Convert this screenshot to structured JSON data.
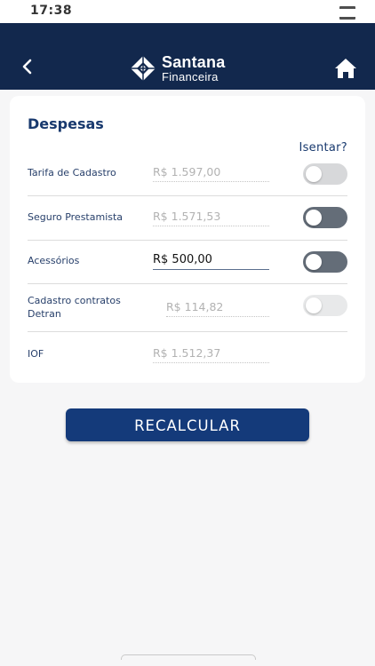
{
  "status_bar": {
    "time": "17:38"
  },
  "header": {
    "brand_name": "Santana",
    "brand_sub": "Financeira",
    "back_icon": "chevron-left-icon",
    "home_icon": "home-icon",
    "background_color": "#12284d"
  },
  "despesas": {
    "title": "Despesas",
    "isentar_label": "Isentar?",
    "rows": [
      {
        "label": "Tarifa de Cadastro",
        "value": "R$ 1.597,00",
        "toggle": "off"
      },
      {
        "label": "Seguro Prestamista",
        "value": "R$ 1.571,53",
        "toggle": "off"
      },
      {
        "label": "Acessórios",
        "value": "R$ 500,00",
        "toggle": "off"
      },
      {
        "label": "Cadastro contratos Detran",
        "value": "R$ 114,82",
        "toggle": "off"
      },
      {
        "label": "IOF",
        "value": "R$ 1.512,37"
      }
    ]
  },
  "actions": {
    "recalculate_label": "RECALCULAR",
    "button_color": "#143a7a"
  },
  "colors": {
    "title": "#18396e",
    "label": "#28406b",
    "toggle_dark": "#646d78",
    "toggle_light": "#d7d8da"
  }
}
